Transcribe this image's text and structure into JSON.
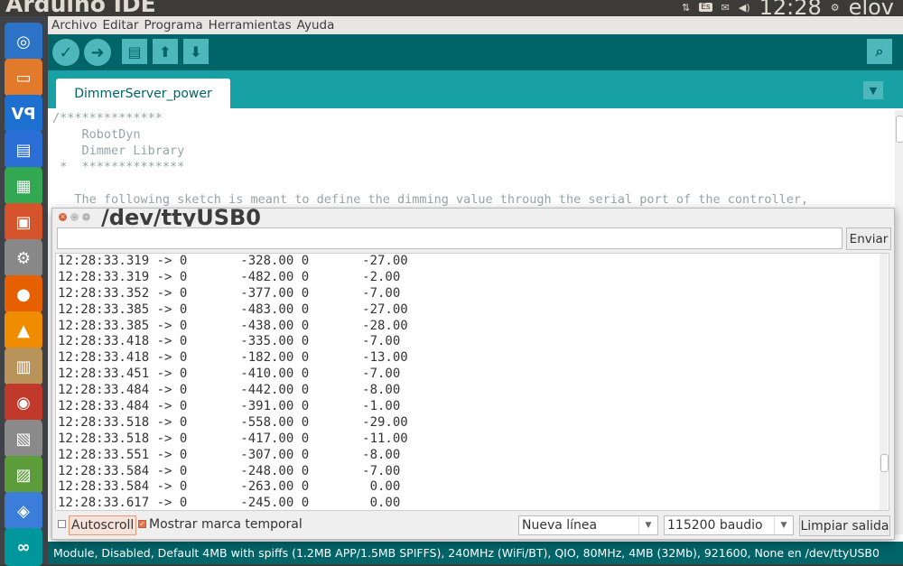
{
  "window": {
    "title": "Arduino IDE"
  },
  "system": {
    "clock": "12:28",
    "user": "elov",
    "kb_layout": "Es"
  },
  "menu": [
    "Archivo",
    "Editar",
    "Programa",
    "Herramientas",
    "Ayuda"
  ],
  "toolbar": {
    "verify": "✓",
    "upload": "➜",
    "new": "▤",
    "open": "⬆",
    "save": "⬇",
    "serial_monitor": "⌕"
  },
  "tab": {
    "name": "DimmerServer_power",
    "menu": "▼"
  },
  "editor": {
    "lines": [
      "/**************",
      "    RobotDyn",
      "    Dimmer Library",
      " *  **************",
      "",
      "   The following sketch is meant to define the dimming value through the serial port of the controller,"
    ]
  },
  "serial_monitor": {
    "title": "/dev/ttyUSB0",
    "input_value": "",
    "send_label": "Enviar",
    "lines": [
      "12:28:33.319 -> 0       -328.00 0       -27.00",
      "12:28:33.319 -> 0       -482.00 0       -2.00",
      "12:28:33.352 -> 0       -377.00 0       -7.00",
      "12:28:33.385 -> 0       -483.00 0       -27.00",
      "12:28:33.385 -> 0       -438.00 0       -28.00",
      "12:28:33.418 -> 0       -335.00 0       -7.00",
      "12:28:33.418 -> 0       -182.00 0       -13.00",
      "12:28:33.451 -> 0       -410.00 0       -7.00",
      "12:28:33.484 -> 0       -442.00 0       -8.00",
      "12:28:33.484 -> 0       -391.00 0       -1.00",
      "12:28:33.518 -> 0       -558.00 0       -29.00",
      "12:28:33.518 -> 0       -417.00 0       -11.00",
      "12:28:33.551 -> 0       -307.00 0       -8.00",
      "12:28:33.584 -> 0       -248.00 0       -7.00",
      "12:28:33.584 -> 0       -263.00 0        0.00",
      "12:28:33.617 -> 0       -245.00 0        0.00"
    ],
    "autoscroll_label": "Autoscroll",
    "autoscroll_checked": false,
    "timestamp_label": "Mostrar marca temporal",
    "timestamp_checked": true,
    "line_ending": "Nueva línea",
    "baud_rate": "115200 baudio",
    "clear_label": "Limpiar salida"
  },
  "status_bar": {
    "text": "Module, Disabled, Default 4MB with spiffs (1.2MB APP/1.5MB SPIFFS), 240MHz (WiFi/BT), QIO, 80MHz, 4MB (32Mb), 921600, None en /dev/ttyUSB0"
  },
  "launcher": {
    "items": [
      {
        "icon": "ubuntu-dash-icon",
        "color": "#2c72c7",
        "glyph": "◎"
      },
      {
        "icon": "files-icon",
        "color": "#e27a2b",
        "glyph": "▭"
      },
      {
        "icon": "vnc-viewer-icon",
        "color": "#1d6fd0",
        "glyph": "Vꟼ"
      },
      {
        "icon": "libreoffice-writer-icon",
        "color": "#2b6fd6",
        "glyph": "▤"
      },
      {
        "icon": "libreoffice-calc-icon",
        "color": "#33a852",
        "glyph": "▦"
      },
      {
        "icon": "libreoffice-impress-icon",
        "color": "#d5542b",
        "glyph": "▣"
      },
      {
        "icon": "system-settings-icon",
        "color": "#888888",
        "glyph": "⚙"
      },
      {
        "icon": "firefox-icon",
        "color": "#e66000",
        "glyph": "●"
      },
      {
        "icon": "vlc-icon",
        "color": "#f08c00",
        "glyph": "▲"
      },
      {
        "icon": "archive-manager-icon",
        "color": "#b8935a",
        "glyph": "▥"
      },
      {
        "icon": "disk-utility-icon",
        "color": "#c0392b",
        "glyph": "◉"
      },
      {
        "icon": "image-editor-icon",
        "color": "#8a8a8a",
        "glyph": "▧"
      },
      {
        "icon": "photos-icon",
        "color": "#5d9c3a",
        "glyph": "▨"
      },
      {
        "icon": "layers-app-icon",
        "color": "#3b7dd8",
        "glyph": "◈"
      },
      {
        "icon": "arduino-icon",
        "color": "#00979c",
        "glyph": "∞"
      }
    ]
  }
}
